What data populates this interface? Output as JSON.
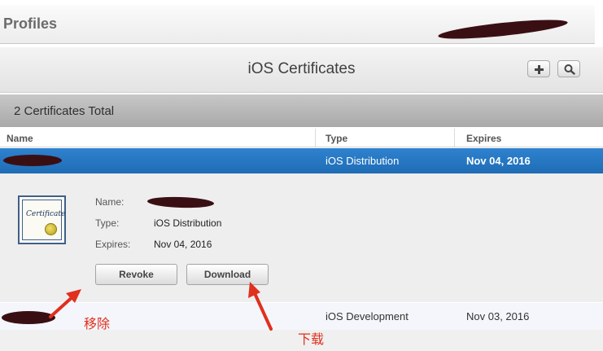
{
  "header": {
    "title": "Profiles"
  },
  "toolbar": {
    "heading": "iOS Certificates",
    "add_icon": "plus-icon",
    "search_icon": "search-icon"
  },
  "summary": {
    "total_text": "2 Certificates Total"
  },
  "table": {
    "columns": [
      "Name",
      "Type",
      "Expires"
    ],
    "rows": [
      {
        "type": "iOS Distribution",
        "expires": "Nov 04, 2016",
        "selected": true
      },
      {
        "type": "iOS Development",
        "expires": "Nov 03, 2016",
        "selected": false
      }
    ]
  },
  "detail": {
    "name_label": "Name:",
    "type_label": "Type:",
    "type_value": "iOS Distribution",
    "expires_label": "Expires:",
    "expires_value": "Nov 04, 2016",
    "certificate_text": "Certificate",
    "revoke_label": "Revoke",
    "download_label": "Download"
  },
  "annotations": {
    "remove": "移除",
    "download": "下载",
    "color": "#e0301e"
  },
  "colors": {
    "selection": "#2a7bc8",
    "redaction": "#3a0f14"
  }
}
